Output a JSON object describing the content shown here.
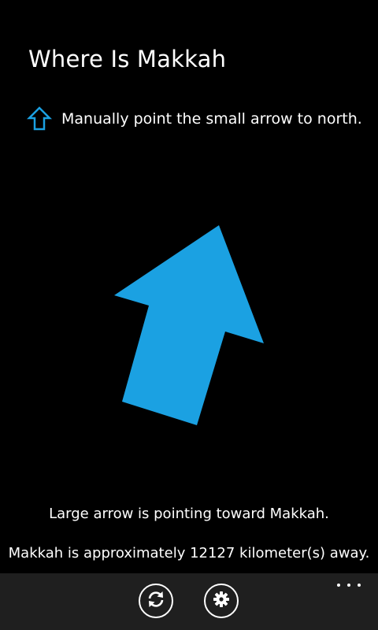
{
  "app": {
    "title": "Where Is Makkah",
    "accent_color": "#1ba1e2"
  },
  "hint": {
    "icon": "up-arrow-outline-icon",
    "text": "Manually point the small arrow to north."
  },
  "compass": {
    "icon": "direction-arrow-icon",
    "bearing_degrees": 20
  },
  "status": {
    "direction_text": "Large arrow is pointing toward Makkah.",
    "distance_text": "Makkah is approximately 12127 kilometer(s) away."
  },
  "appbar": {
    "buttons": [
      {
        "icon": "refresh-icon"
      },
      {
        "icon": "settings-gear-icon"
      }
    ],
    "more_icon": "ellipsis-icon"
  }
}
